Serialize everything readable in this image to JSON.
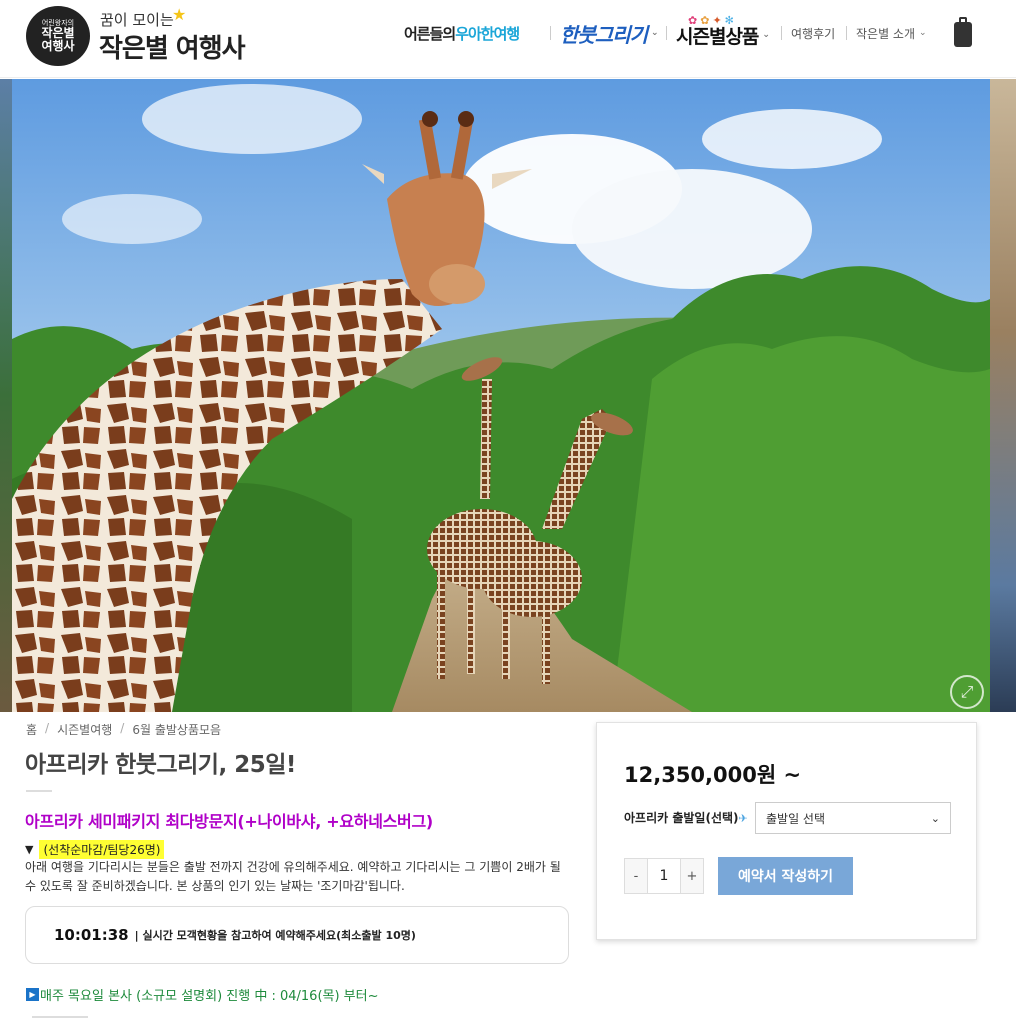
{
  "header": {
    "logo_badge": [
      "어린왕자의",
      "작은별",
      "여행사"
    ],
    "logo_tagline": "꿈이 모이는",
    "logo_name": "작은별 여행사",
    "nav": {
      "seniors_prefix": "어른들의",
      "seniors_accent": "우아한여행",
      "hanbut": "한붓그리기",
      "season": "시즌별상품",
      "review": "여행후기",
      "about": "작은별 소개"
    },
    "icons": [
      "cart-icon",
      "chevron-down-icon",
      "star-icon"
    ]
  },
  "hero": {
    "zoom_icon": "expand-icon",
    "colors": {
      "sky": "#7fb2e6",
      "foliage": "#3f8f2e",
      "road": "#b9a27d"
    }
  },
  "breadcrumb": [
    "홈",
    "시즌별여행",
    "6월 출발상품모음"
  ],
  "product": {
    "title": "아프리카 한붓그리기, 25일!",
    "subtitle": "아프리카 세미패키지 최다방문지(+나이바샤, +요하네스버그)",
    "notice_arrow": "▼",
    "notice_highlight": "(선착순마감/팀당26명)",
    "notice_body": "아래 여행을 기다리시는 분들은 출발 전까지 건강에 유의해주세요. 예약하고 기다리시는 그 기쁨이 2배가 될 수 있도록 잘 준비하겠습니다. 본 상품의 인기 있는 날짜는 '조기마감'됩니다.",
    "countdown_time": "10:01:38",
    "countdown_msg": "| 실시간 모객현황을 참고하여 예약해주세요(최소출발 10명)",
    "briefing": "매주 목요일 본사 (소규모 설명회) 진행 中 : 04/16(목) 부터~"
  },
  "purchase": {
    "price": "12,350,000원 ~",
    "depart_label": "아프리카 출발일(선택)",
    "depart_placeholder": "출발일 선택",
    "qty_minus": "-",
    "qty_value": "1",
    "qty_plus": "+",
    "book_label": "예약서 작성하기",
    "accent_color": "#79a7d8"
  }
}
